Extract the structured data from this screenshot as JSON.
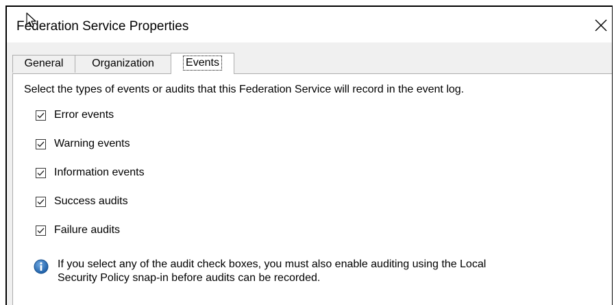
{
  "window": {
    "title": "Federation Service Properties",
    "close_label": "×"
  },
  "tabs": [
    {
      "label": "General",
      "selected": false
    },
    {
      "label": "Organization",
      "selected": false
    },
    {
      "label": "Events",
      "selected": true
    }
  ],
  "events_tab": {
    "intro": "Select the types of events or audits that this Federation Service will record in the event log.",
    "options": [
      {
        "label": "Error events",
        "checked": true
      },
      {
        "label": "Warning events",
        "checked": true
      },
      {
        "label": "Information events",
        "checked": true
      },
      {
        "label": "Success audits",
        "checked": true
      },
      {
        "label": "Failure audits",
        "checked": true
      }
    ],
    "info": {
      "icon": "info-icon",
      "line1": "If you select any of the audit check boxes, you must also enable auditing using the Local",
      "line2": "Security Policy snap-in before audits can be recorded."
    }
  },
  "colors": {
    "dialog_background": "#f0f0f0",
    "panel_background": "#ffffff",
    "info_icon": "#1d5fa8"
  }
}
